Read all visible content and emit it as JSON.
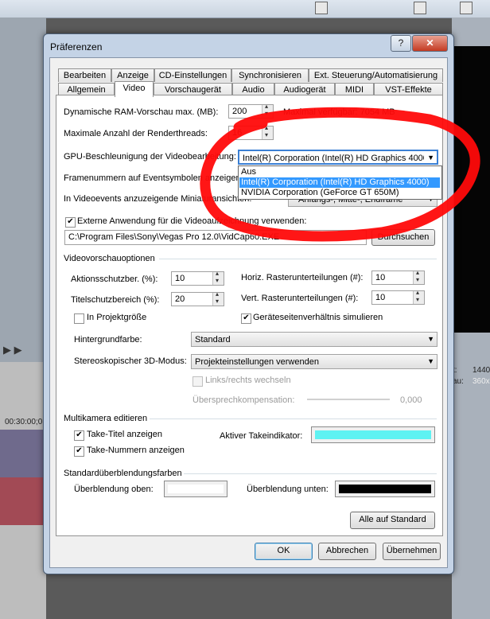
{
  "background": {
    "timeline_time": "00:30:00;0",
    "right_text_1": "1440",
    "right_text_2": "360x",
    "right_text_3": "t:",
    "right_text_4": "au:"
  },
  "dialog": {
    "title": "Präferenzen",
    "help_label": "?",
    "close_label": "✕",
    "tabs_row1": [
      "Bearbeiten",
      "Anzeige",
      "CD-Einstellungen",
      "Synchronisieren",
      "Ext. Steuerung/Automatisierung"
    ],
    "tabs_row2": [
      "Allgemein",
      "Video",
      "Vorschaugerät",
      "Audio",
      "Audiogerät",
      "MIDI",
      "VST-Effekte"
    ],
    "active_tab": "Video"
  },
  "video": {
    "ram_preview_label": "Dynamische RAM-Vorschau max. (MB):",
    "ram_preview_value": "200",
    "ram_available": "Maximal verfügbar: 7054 MB",
    "render_threads_label": "Maximale Anzahl der Renderthreads:",
    "render_threads_value": "16",
    "gpu_label": "GPU-Beschleunigung der Videobearbeitung:",
    "gpu_selected": "Intel(R) Corporation (Intel(R) HD Graphics 4000)",
    "gpu_options": [
      "Aus",
      "Intel(R) Corporation (Intel(R) HD Graphics 4000)",
      "NVIDIA Corporation (GeForce GT 650M)"
    ],
    "frame_numbers_label": "Framenummern auf Eventsymbolen anzeigen als:",
    "thumbnails_label": "In Videoevents anzuzeigende Miniaturansichten:",
    "thumbnails_value": "Anfangs-, Mitte-, Endframe",
    "external_app_label": "Externe Anwendung für die Videoaufzeichnung verwenden:",
    "external_app_path": "C:\\Program Files\\Sony\\Vegas Pro 12.0\\VidCap60.EXE",
    "browse_label": "Durchsuchen"
  },
  "preview_options": {
    "section_label": "Videovorschauoptionen",
    "action_safe_label": "Aktionsschutzber. (%):",
    "action_safe_value": "10",
    "title_safe_label": "Titelschutzbereich (%):",
    "title_safe_value": "20",
    "horiz_grid_label": "Horiz. Rasterunterteilungen (#):",
    "horiz_grid_value": "10",
    "vert_grid_label": "Vert. Rasterunterteilungen (#):",
    "vert_grid_value": "10",
    "project_size_label": "In Projektgröße",
    "aspect_label": "Geräteseitenverhältnis simulieren",
    "background_label": "Hintergrundfarbe:",
    "background_value": "Standard",
    "stereo_label": "Stereoskopischer 3D-Modus:",
    "stereo_value": "Projekteinstellungen verwenden",
    "swap_label": "Links/rechts wechseln",
    "crosstalk_label": "Übersprechkompensation:",
    "crosstalk_value": "0,000"
  },
  "multicam": {
    "section_label": "Multikamera editieren",
    "take_titles_label": "Take-Titel anzeigen",
    "take_numbers_label": "Take-Nummern anzeigen",
    "active_take_label": "Aktiver Takeindikator:",
    "active_take_color": "#5ef2f2"
  },
  "crossfade": {
    "section_label": "Standardüberblendungsfarben",
    "top_label": "Überblendung oben:",
    "top_color": "#ffffff",
    "bottom_label": "Überblendung unten:",
    "bottom_color": "#000000"
  },
  "buttons": {
    "defaults": "Alle auf Standard",
    "ok": "OK",
    "cancel": "Abbrechen",
    "apply": "Übernehmen"
  }
}
